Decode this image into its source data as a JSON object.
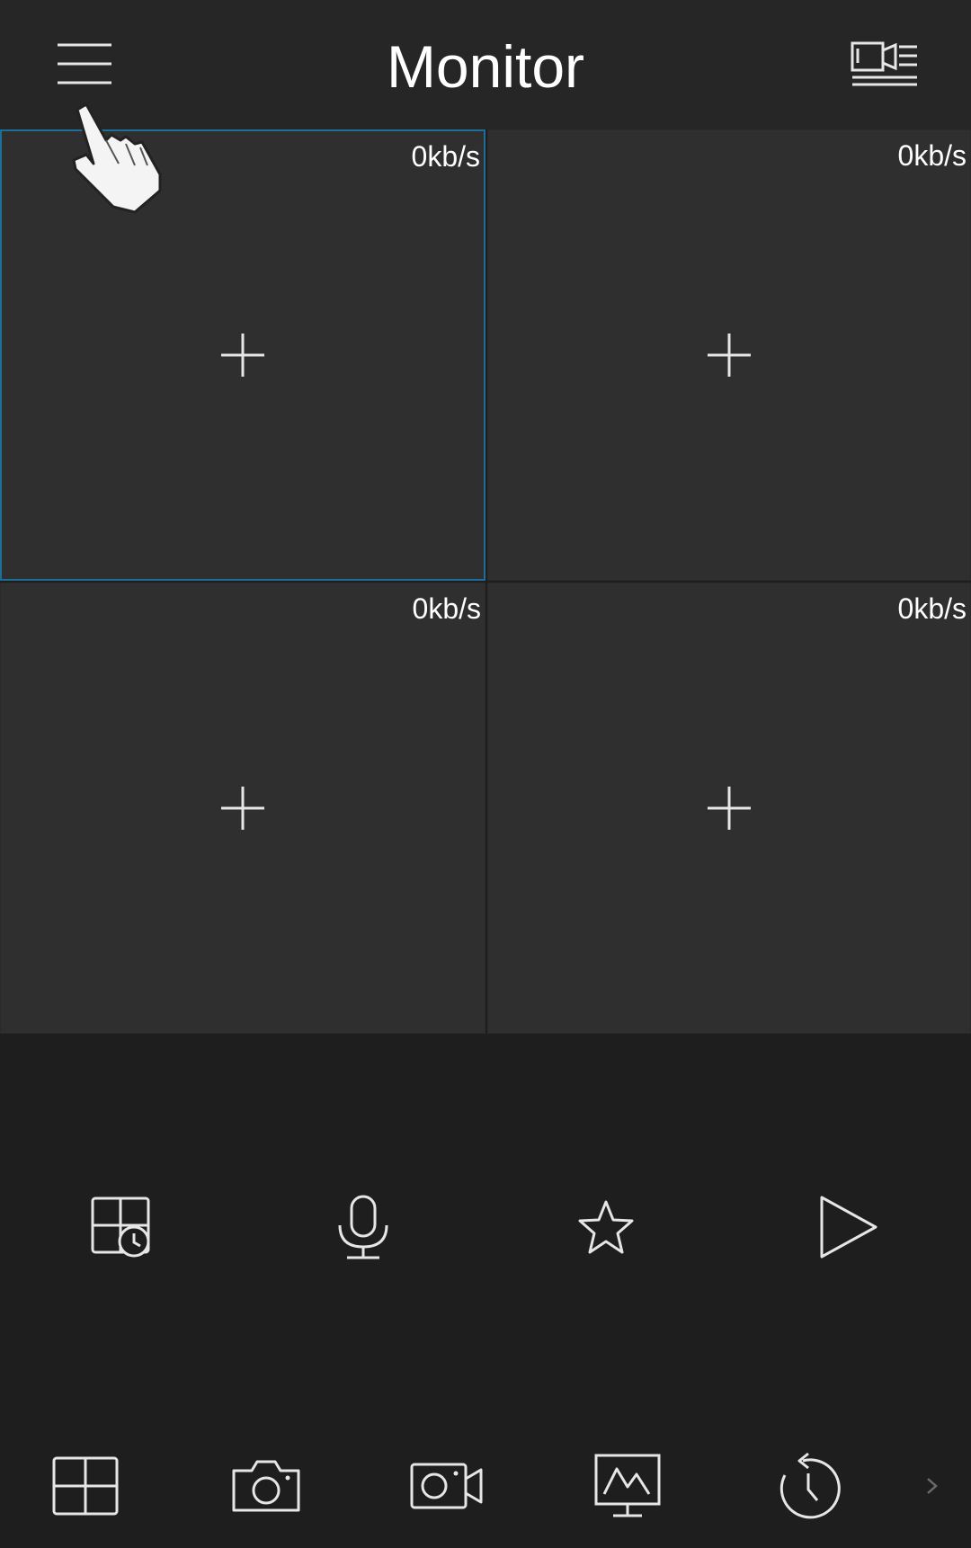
{
  "header": {
    "title": "Monitor",
    "menu_icon": "hamburger-menu-icon",
    "device_list_icon": "device-list-icon"
  },
  "grid": {
    "tiles": [
      {
        "rate": "0kb/s",
        "selected": true
      },
      {
        "rate": "0kb/s",
        "selected": false
      },
      {
        "rate": "0kb/s",
        "selected": false
      },
      {
        "rate": "0kb/s",
        "selected": false
      }
    ],
    "add_icon": "plus-icon"
  },
  "controls": [
    {
      "icon": "playback-schedule-icon"
    },
    {
      "icon": "microphone-icon"
    },
    {
      "icon": "star-icon"
    },
    {
      "icon": "play-icon"
    }
  ],
  "bottom_bar": [
    {
      "icon": "split-screen-icon"
    },
    {
      "icon": "camera-snapshot-icon"
    },
    {
      "icon": "video-record-icon"
    },
    {
      "icon": "monitor-display-icon"
    },
    {
      "icon": "history-playback-icon"
    },
    {
      "icon": "chevron-right-icon"
    }
  ],
  "colors": {
    "background": "#1e1e1e",
    "header": "#262626",
    "tile": "#2f2f2f",
    "selected_border": "#1d6e98",
    "icon": "#e6e6e6"
  }
}
